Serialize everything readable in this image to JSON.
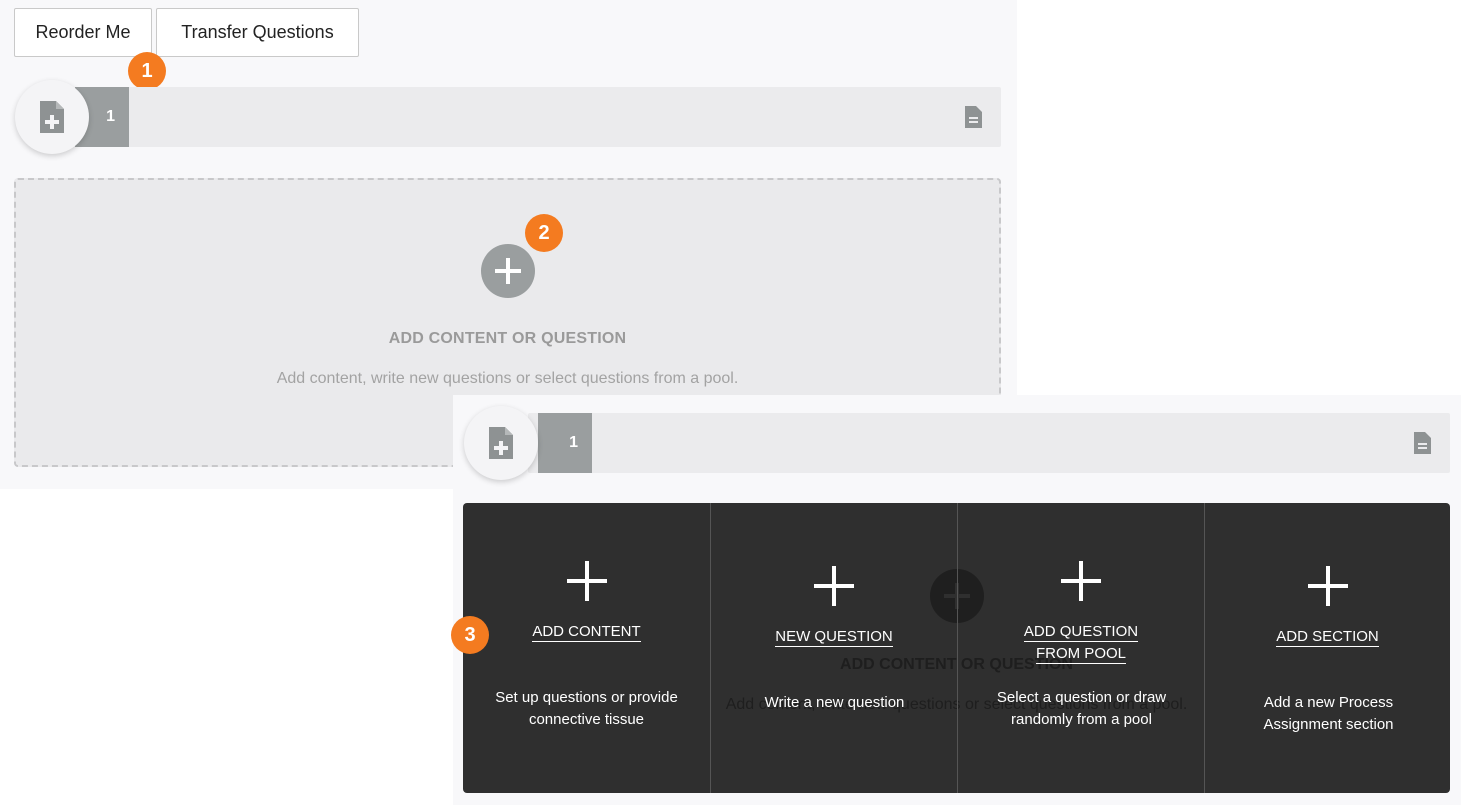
{
  "toolbar": {
    "reorder_label": "Reorder Me",
    "transfer_label": "Transfer Questions"
  },
  "callouts": [
    "1",
    "2",
    "3"
  ],
  "top_section": {
    "number": "1"
  },
  "dropzone": {
    "title": "ADD CONTENT OR QUESTION",
    "description": "Add content, write new questions or select questions from a pool."
  },
  "bottom_section": {
    "number": "1",
    "ghost_title": "ADD CONTENT OR QUESTION",
    "ghost_description": "Add content, write new questions or select questions from a pool."
  },
  "menu": {
    "options": [
      {
        "label_line1": "ADD CONTENT",
        "label_line2": "",
        "description": "Set up questions or provide connective tissue"
      },
      {
        "label_line1": "NEW QUESTION",
        "label_line2": "",
        "description": "Write a new question"
      },
      {
        "label_line1": "ADD QUESTION",
        "label_line2": "FROM POOL",
        "description": "Select a question or draw randomly from a pool"
      },
      {
        "label_line1": "ADD SECTION",
        "label_line2": "",
        "description": "Add a new Process Assignment section"
      }
    ]
  },
  "colors": {
    "accent": "#f47b20",
    "menu_bg": "#2f2f2f",
    "section_number_bg": "#9a9e9f"
  }
}
